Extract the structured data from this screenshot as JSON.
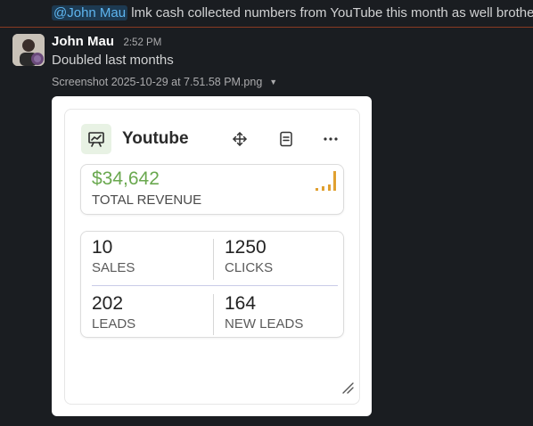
{
  "previous_message": {
    "mention": "@John Mau",
    "text": " lmk cash collected numbers from YouTube this month as well brother"
  },
  "message": {
    "author": "John Mau",
    "time": "2:52 PM",
    "text": "Doubled last months",
    "attachment_name": "Screenshot 2025-10-29 at 7.51.58 PM.png"
  },
  "widget": {
    "title": "Youtube",
    "revenue": {
      "value": "$34,642",
      "label": "TOTAL REVENUE"
    },
    "stats": [
      {
        "value": "10",
        "label": "SALES"
      },
      {
        "value": "1250",
        "label": "CLICKS"
      },
      {
        "value": "202",
        "label": "LEADS"
      },
      {
        "value": "164",
        "label": "NEW LEADS"
      }
    ]
  },
  "colors": {
    "background": "#1a1d21",
    "mention_bg": "#1d3a52",
    "mention_text": "#5eb5ef",
    "revenue_green": "#6aa84f",
    "trend_orange": "#e0a030",
    "divider": "#8a3a22"
  },
  "icons": {
    "widget": "presentation-chart-icon",
    "move": "move-arrows-icon",
    "notes": "document-icon",
    "more": "more-dots-icon",
    "trend": "signal-bars-icon",
    "resize": "resize-handle-icon",
    "caret": "caret-down-icon"
  }
}
